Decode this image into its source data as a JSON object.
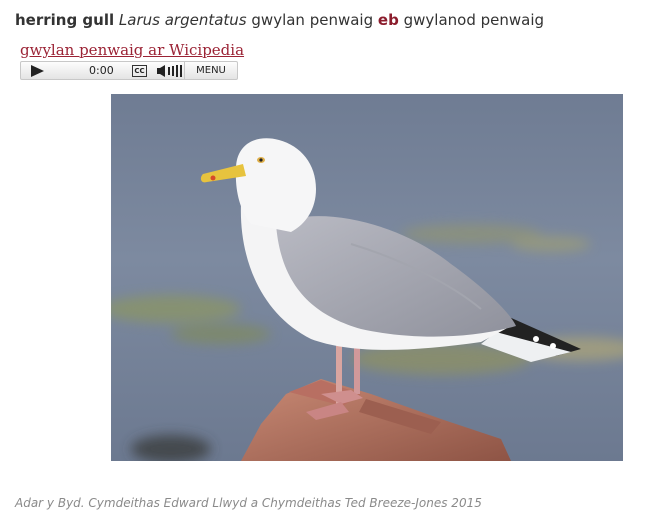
{
  "entry": {
    "english": "herring gull",
    "latin": "Larus argentatus",
    "welsh": "gwylan penwaig",
    "gender": "eb",
    "plural": "gwylanod penwaig"
  },
  "wiki_link": "gwylan penwaig ar Wicipedia",
  "player": {
    "time": "0:00",
    "cc_label": "CC",
    "menu_label": "MENU",
    "play_icon": "play-icon",
    "volume_icon": "volume-icon"
  },
  "credit": "Adar y Byd. Cymdeithas Edward Llwyd a Chymdeithas Ted Breeze-Jones 2015"
}
